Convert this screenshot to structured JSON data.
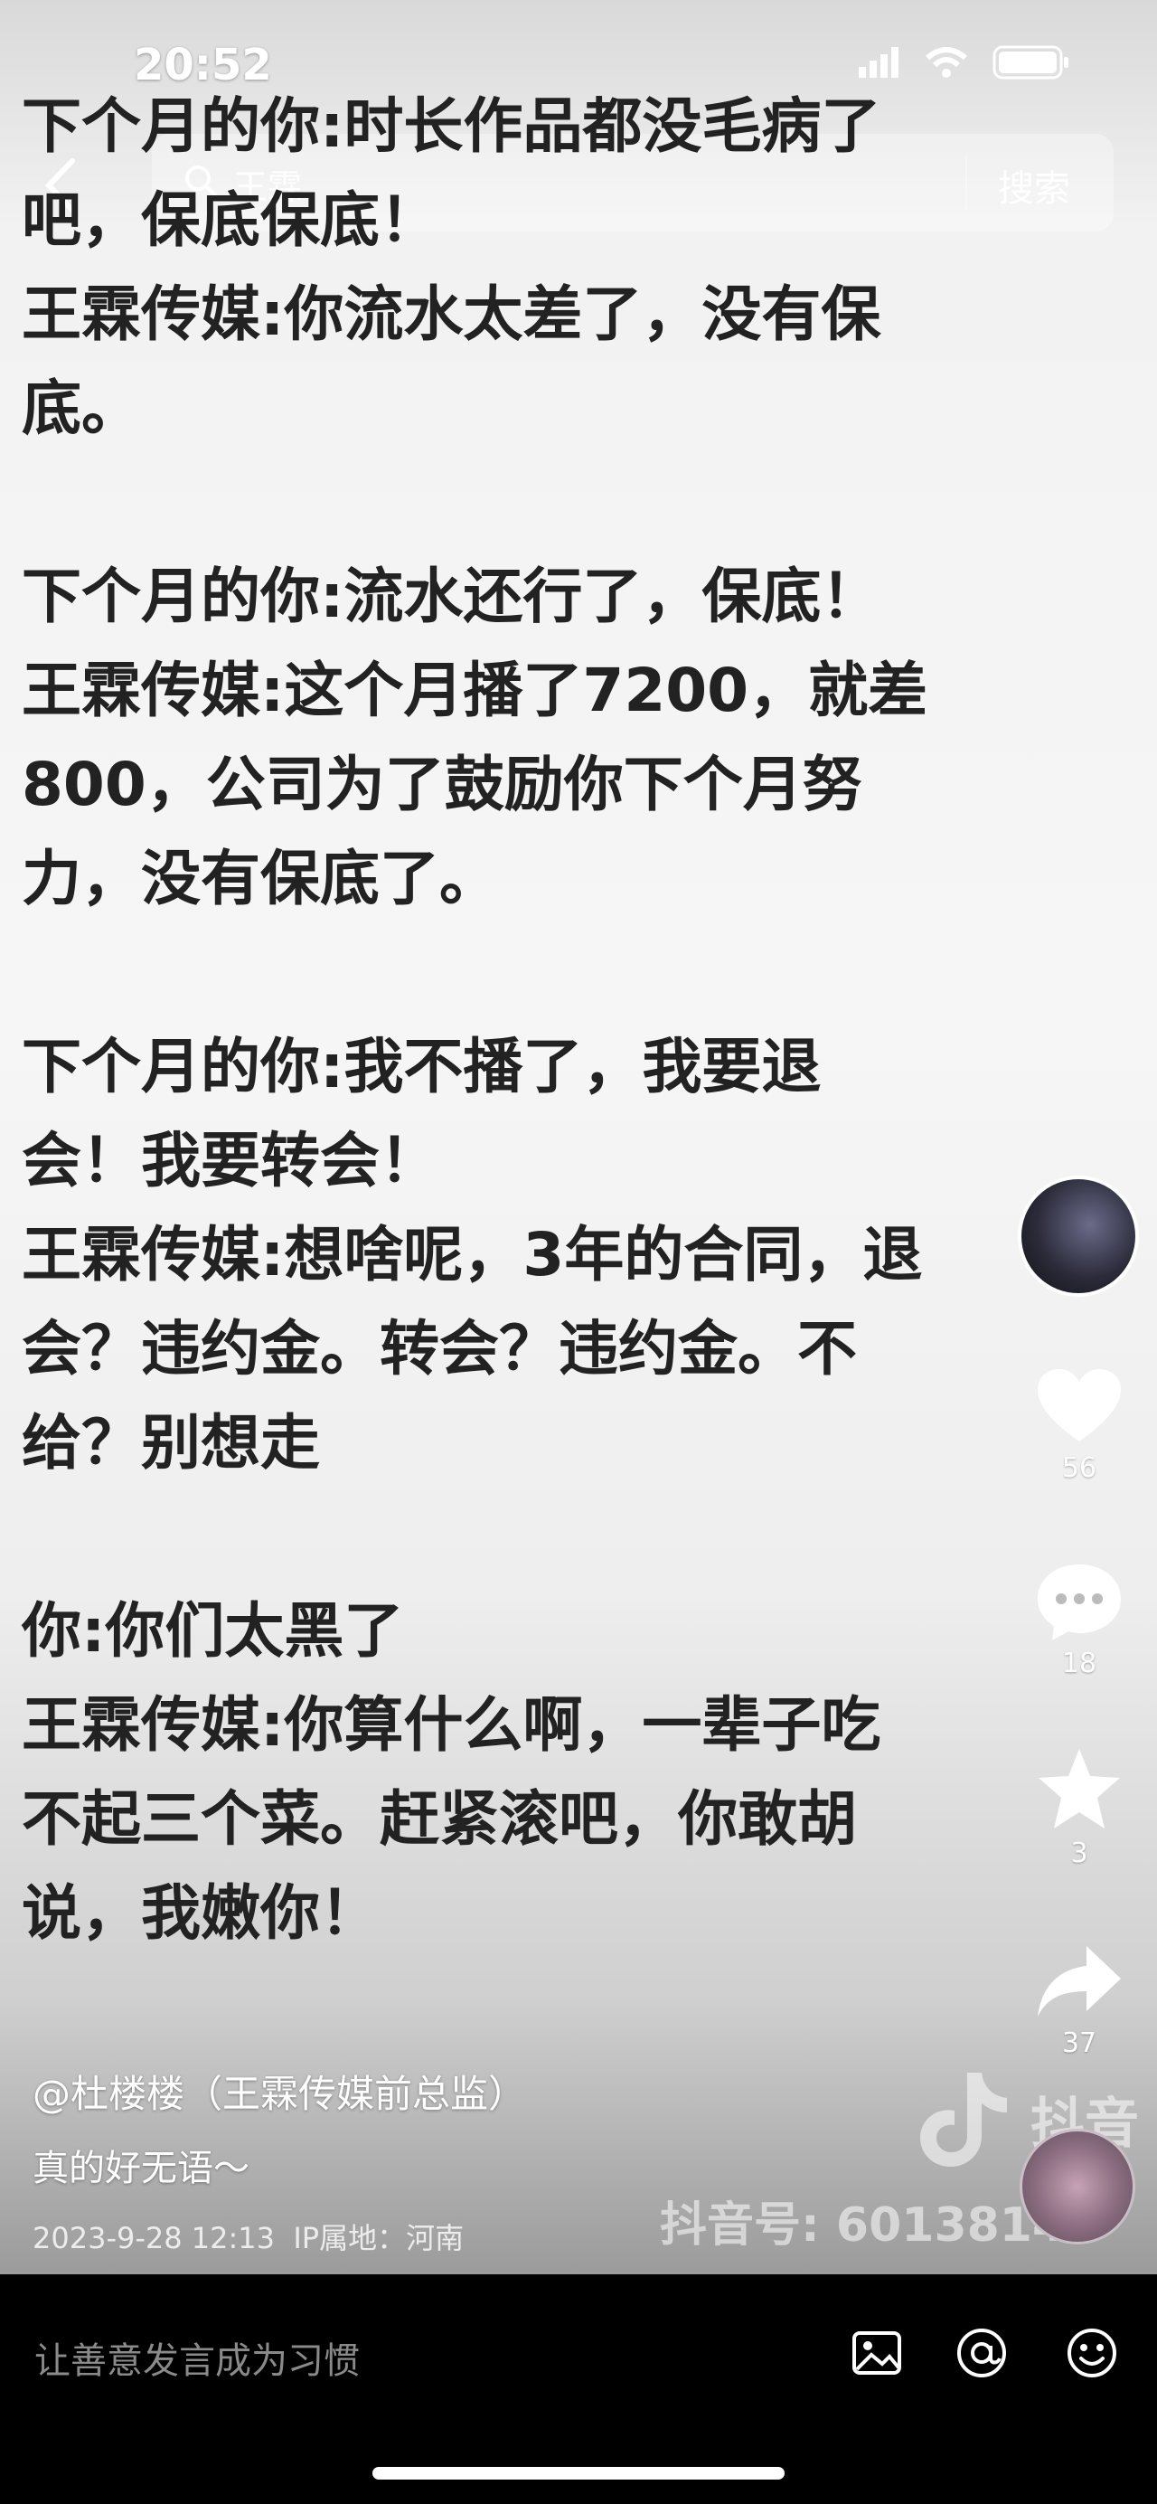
{
  "status": {
    "time": "20:52"
  },
  "search": {
    "query": "王霖",
    "button_label": "搜索"
  },
  "post_text": "下个月的你:时长作品都没毛病了\n吧，保底保底！\n王霖传媒:你流水太差了，没有保\n底。\n\n下个月的你:流水还行了，保底！\n王霖传媒:这个月播了7200，就差\n800，公司为了鼓励你下个月努\n力，没有保底了。\n\n下个月的你:我不播了，我要退\n会！我要转会！\n王霖传媒:想啥呢，3年的合同，退\n会？违约金。转会？违约金。不\n给？别想走\n\n你:你们太黑了\n王霖传媒:你算什么啊，一辈子吃\n不起三个菜。赶紧滚吧，你敢胡\n说，我嫩你！",
  "actions": {
    "likes": "56",
    "comments": "18",
    "favorites": "3",
    "shares": "37"
  },
  "author": "@杜楼楼（王霖传媒前总监）",
  "caption": "真的好无语～",
  "meta": {
    "date": "2023-9-28 12:13",
    "ip": "IP属地：河南"
  },
  "watermark": {
    "brand": "抖音",
    "id": "抖音号: 60138144"
  },
  "comment_bar": {
    "placeholder": "让善意发言成为习惯"
  },
  "colors": {
    "text": "#222222",
    "overlay_text": "#ffffff",
    "bottom_bar": "#000000"
  },
  "icons": [
    "back-icon",
    "search-icon",
    "heart-icon",
    "comment-icon",
    "star-icon",
    "share-icon",
    "image-icon",
    "at-icon",
    "emoji-icon"
  ]
}
